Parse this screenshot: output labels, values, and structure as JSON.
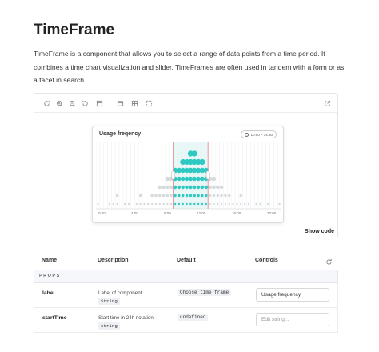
{
  "page": {
    "title": "TimeFrame",
    "description": "TimeFrame is a component that allows you to select a range of data points from a time period. It combines a time chart visualization and slider. TimeFrames are often used in tandem with a form or as a facet in search."
  },
  "toolbar": {
    "icons": [
      "refresh-icon",
      "zoom-in-icon",
      "zoom-out-icon",
      "reset-zoom-icon",
      "image-icon",
      "layout-icon",
      "grid-icon",
      "outline-icon",
      "external-link-icon"
    ]
  },
  "preview": {
    "card_title": "Usage freqency",
    "range_chip": "10:00 – 14:30",
    "x_labels": [
      "0:00",
      "4:00",
      "8:00",
      "12:00",
      "16:00",
      "20:00"
    ],
    "show_code": "Show code",
    "colors": {
      "accent": "#2ec9c0",
      "dot": "#d6d9dc",
      "selection": "#e8f7f8",
      "handle": "#e07a7a"
    }
  },
  "chart_data": {
    "type": "scatter",
    "title": "Usage freqency",
    "x_labels": [
      "0:00",
      "4:00",
      "8:00",
      "12:00",
      "16:00",
      "20:00"
    ],
    "xlim": [
      0,
      24
    ],
    "selection": [
      "10:00",
      "14:30"
    ]
  },
  "table": {
    "headers": {
      "name": "Name",
      "description": "Description",
      "default": "Default",
      "controls": "Controls"
    },
    "section": "PROPS",
    "rows": [
      {
        "name": "label",
        "description": "Label of component",
        "type": "String",
        "default": "Choose time frame",
        "control_value": "Usage frequency",
        "control_placeholder": ""
      },
      {
        "name": "startTime",
        "description": "Start time in 24h notation",
        "type": "string",
        "default": "undefined",
        "control_value": "",
        "control_placeholder": "Edit string..."
      }
    ]
  }
}
